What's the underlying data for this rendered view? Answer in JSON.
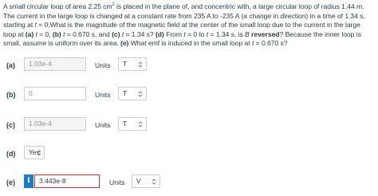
{
  "question": {
    "s1": "A small circular loop of area 2.25 cm",
    "sup": "2",
    "s2": " is placed in the plane of, and concentric with, a large circular loop of radius 1.44 m. The current in the large loop is changed at a constant rate from 235 A to -235 A (a change in direction) in a time of 1.34 s, starting at ",
    "t_var": "t",
    "s3": " = 0.What is the magnitude of the magnetic field at the center of the small loop due to the current in the large loop at ",
    "a_lbl": "(a)",
    "s4": " ",
    "s5": " = 0, ",
    "b_lbl": "(b)",
    "s6": " = 0.670 s, and ",
    "c_lbl": "(c)",
    "s7": " = 1.34 s? ",
    "d_lbl": "(d)",
    "s8": " From ",
    "s9": " = 0 to ",
    "s10": " = 1.34 s, is ",
    "b_var": "B",
    "s11": " reversed",
    "s12": "? Because the inner loop is small, assume is uniform over its area. ",
    "e_lbl": "(e)",
    "s13": " What emf is induced in the small loop at ",
    "s14": " = 0.670 s?"
  },
  "parts": [
    {
      "label": "(a)",
      "value": "1.03e-4",
      "units_label": "Units",
      "unit": "T"
    },
    {
      "label": "(b)",
      "value": "0",
      "units_label": "Units",
      "unit": "T"
    },
    {
      "label": "(c)",
      "value": "1.03e-4",
      "units_label": "Units",
      "unit": "T"
    },
    {
      "label": "(d)",
      "select": "Yes"
    },
    {
      "label": "(e)",
      "info": "i",
      "value": "3.443e-8",
      "units_label": "Units",
      "unit": "V"
    }
  ],
  "colors": {
    "error_border": "#b8373e",
    "info_bg": "#1f7ac4"
  }
}
